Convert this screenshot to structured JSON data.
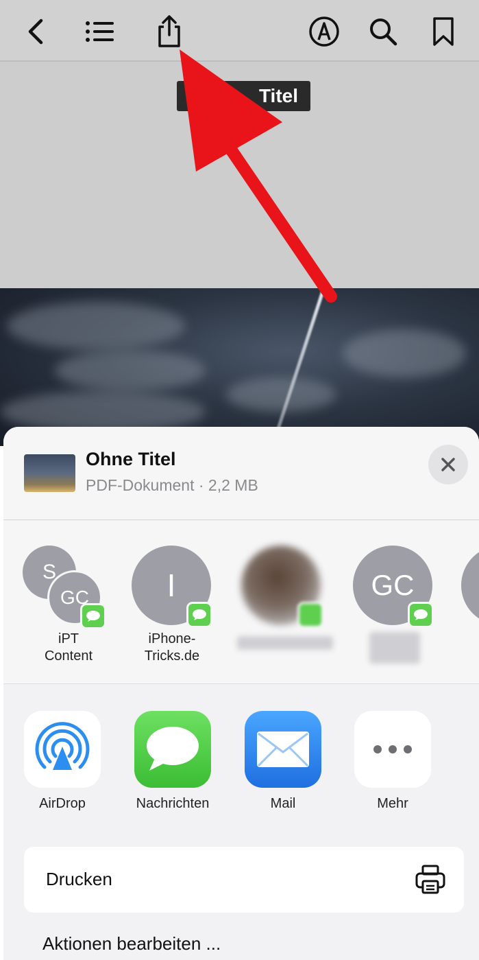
{
  "toolbar": {
    "icons": [
      "back-chevron-icon",
      "list-icon",
      "share-icon",
      "markup-pen-icon",
      "search-icon",
      "bookmark-icon"
    ]
  },
  "document": {
    "title": "Titel"
  },
  "share_sheet": {
    "file_name": "Ohne Titel",
    "file_meta": "PDF-Dokument · 2,2 MB",
    "people": [
      {
        "initials_back": "S",
        "initials_front": "GC",
        "label_line1": "iPT",
        "label_line2": "Content"
      },
      {
        "initials": "I",
        "label_line1": "iPhone-",
        "label_line2": "Tricks.de"
      },
      {
        "initials": "",
        "label_line1": "",
        "label_line2": ""
      },
      {
        "initials": "GC",
        "label_line1": "",
        "label_line2": ""
      }
    ],
    "apps": [
      {
        "label": "AirDrop"
      },
      {
        "label": "Nachrichten"
      },
      {
        "label": "Mail"
      },
      {
        "label": "Mehr"
      }
    ],
    "print_label": "Drucken",
    "edit_actions_label": "Aktionen bearbeiten ..."
  },
  "colors": {
    "arrow": "#e8141a",
    "messages_green": "#5fcf50",
    "mail_blue": "#2f86f0",
    "airdrop_blue": "#2b8ef0"
  }
}
